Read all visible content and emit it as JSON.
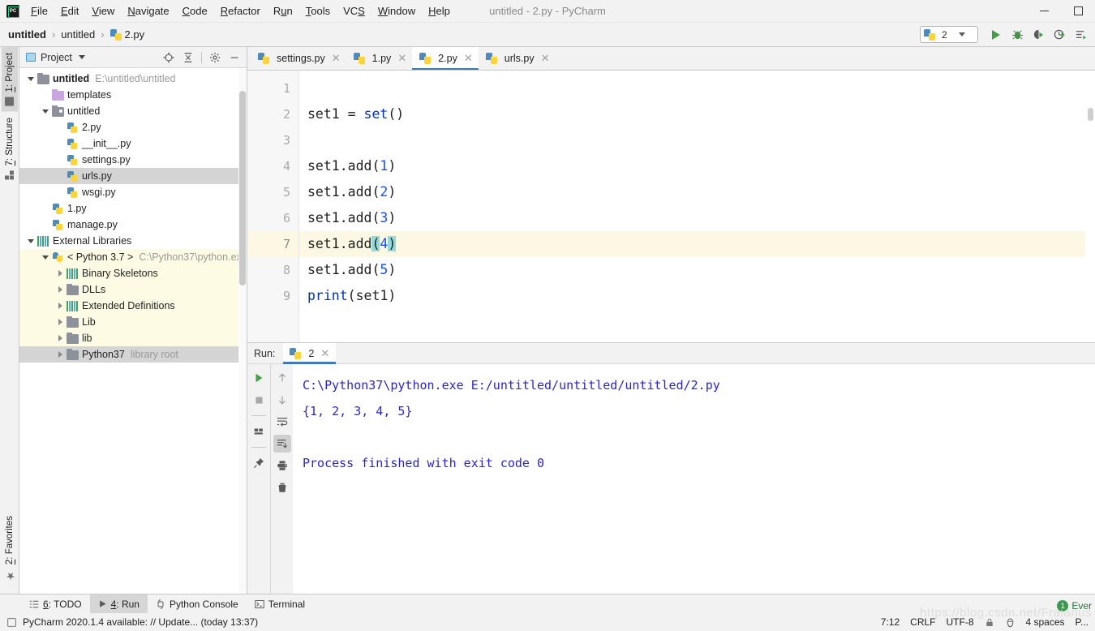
{
  "window": {
    "title": "untitled - 2.py - PyCharm",
    "logo_text": "PC",
    "minimize_icon": "minimize-icon",
    "maximize_icon": "maximize-icon"
  },
  "menu": [
    {
      "label": "File",
      "mnemonic": "F"
    },
    {
      "label": "Edit",
      "mnemonic": "E"
    },
    {
      "label": "View",
      "mnemonic": "V"
    },
    {
      "label": "Navigate",
      "mnemonic": "N"
    },
    {
      "label": "Code",
      "mnemonic": "C"
    },
    {
      "label": "Refactor",
      "mnemonic": "R"
    },
    {
      "label": "Run",
      "mnemonic": "u"
    },
    {
      "label": "Tools",
      "mnemonic": "T"
    },
    {
      "label": "VCS",
      "mnemonic": "S"
    },
    {
      "label": "Window",
      "mnemonic": "W"
    },
    {
      "label": "Help",
      "mnemonic": "H"
    }
  ],
  "breadcrumb": {
    "items": [
      "untitled",
      "untitled",
      "2.py"
    ],
    "separator": "›"
  },
  "run_config": {
    "name": "2",
    "icon": "python-file-icon",
    "buttons": [
      "run-button",
      "debug-button",
      "run-with-coverage-button",
      "profile-button",
      "more-run-button"
    ]
  },
  "left_stripe": {
    "top_tabs": [
      {
        "label": "1: Project",
        "mnemonic": "1",
        "icon": "project-folder-icon",
        "active": true
      },
      {
        "label": "7: Structure",
        "mnemonic": "7",
        "icon": "structure-icon",
        "active": false
      }
    ],
    "bottom_tabs": [
      {
        "label": "2: Favorites",
        "mnemonic": "2",
        "icon": "star-icon",
        "active": false
      }
    ]
  },
  "project_panel": {
    "title": "Project",
    "toolbar_icons": [
      "locate-target-icon",
      "collapse-all-icon",
      "settings-gear-icon",
      "hide-panel-icon"
    ],
    "tree": [
      {
        "depth": 0,
        "arrow": "down",
        "icon": "folder-icon",
        "label": "untitled",
        "sub": "E:\\untitled\\untitled",
        "bold": true,
        "state": "normal"
      },
      {
        "depth": 1,
        "arrow": "none",
        "icon": "folder-purple-icon",
        "label": "templates",
        "sub": "",
        "bold": false,
        "state": "normal"
      },
      {
        "depth": 1,
        "arrow": "down",
        "icon": "folder-source-icon",
        "label": "untitled",
        "sub": "",
        "bold": false,
        "state": "normal"
      },
      {
        "depth": 2,
        "arrow": "none",
        "icon": "python-file-icon",
        "label": "2.py",
        "sub": "",
        "bold": false,
        "state": "normal"
      },
      {
        "depth": 2,
        "arrow": "none",
        "icon": "python-file-icon",
        "label": "__init__.py",
        "sub": "",
        "bold": false,
        "state": "normal"
      },
      {
        "depth": 2,
        "arrow": "none",
        "icon": "python-file-icon",
        "label": "settings.py",
        "sub": "",
        "bold": false,
        "state": "normal"
      },
      {
        "depth": 2,
        "arrow": "none",
        "icon": "python-file-icon",
        "label": "urls.py",
        "sub": "",
        "bold": false,
        "state": "selected"
      },
      {
        "depth": 2,
        "arrow": "none",
        "icon": "python-file-icon",
        "label": "wsgi.py",
        "sub": "",
        "bold": false,
        "state": "normal"
      },
      {
        "depth": 1,
        "arrow": "none",
        "icon": "python-file-icon",
        "label": "1.py",
        "sub": "",
        "bold": false,
        "state": "normal"
      },
      {
        "depth": 1,
        "arrow": "none",
        "icon": "python-file-icon",
        "label": "manage.py",
        "sub": "",
        "bold": false,
        "state": "normal"
      },
      {
        "depth": 0,
        "arrow": "down",
        "icon": "library-icon",
        "label": "External Libraries",
        "sub": "",
        "bold": false,
        "state": "normal"
      },
      {
        "depth": 1,
        "arrow": "down",
        "icon": "python-sdk-icon",
        "label": "< Python 3.7 >",
        "sub": "C:\\Python37\\python.exe",
        "bold": false,
        "state": "yellow"
      },
      {
        "depth": 2,
        "arrow": "right",
        "icon": "library-icon",
        "label": "Binary Skeletons",
        "sub": "",
        "bold": false,
        "state": "yellow"
      },
      {
        "depth": 2,
        "arrow": "right",
        "icon": "folder-icon",
        "label": "DLLs",
        "sub": "",
        "bold": false,
        "state": "yellow"
      },
      {
        "depth": 2,
        "arrow": "right",
        "icon": "library-icon",
        "label": "Extended Definitions",
        "sub": "",
        "bold": false,
        "state": "yellow"
      },
      {
        "depth": 2,
        "arrow": "right",
        "icon": "folder-icon",
        "label": "Lib",
        "sub": "",
        "bold": false,
        "state": "yellow"
      },
      {
        "depth": 2,
        "arrow": "right",
        "icon": "folder-icon",
        "label": "lib",
        "sub": "",
        "bold": false,
        "state": "yellow"
      },
      {
        "depth": 2,
        "arrow": "right",
        "icon": "folder-icon",
        "label": "Python37",
        "sub": "library root",
        "bold": false,
        "state": "selected"
      }
    ]
  },
  "editor": {
    "tabs": [
      {
        "label": "settings.py",
        "icon": "python-file-icon",
        "active": false,
        "close_icon": "close-icon"
      },
      {
        "label": "1.py",
        "icon": "python-file-icon",
        "active": false,
        "close_icon": "close-icon"
      },
      {
        "label": "2.py",
        "icon": "python-file-icon",
        "active": true,
        "close_icon": "close-icon"
      },
      {
        "label": "urls.py",
        "icon": "python-file-icon",
        "active": false,
        "close_icon": "close-icon"
      }
    ],
    "line_numbers": [
      "1",
      "2",
      "3",
      "4",
      "5",
      "6",
      "7",
      "8",
      "9"
    ],
    "current_line": 7,
    "lines": [
      {
        "n": 1,
        "text": ""
      },
      {
        "n": 2,
        "text": "set1 = set()"
      },
      {
        "n": 3,
        "text": ""
      },
      {
        "n": 4,
        "text": "set1.add(1)"
      },
      {
        "n": 5,
        "text": "set1.add(2)"
      },
      {
        "n": 6,
        "text": "set1.add(3)"
      },
      {
        "n": 7,
        "text": "set1.add(4)"
      },
      {
        "n": 8,
        "text": "set1.add(5)"
      },
      {
        "n": 9,
        "text": "print(set1)"
      }
    ]
  },
  "run_window": {
    "label": "Run:",
    "tab_label": "2",
    "tab_icon": "python-file-icon",
    "left_tools": [
      "rerun-button",
      "stop-button",
      "restore-layout-button",
      "pin-tab-button"
    ],
    "right_tools": [
      "up-stack-button",
      "down-stack-button",
      "soft-wrap-button",
      "scroll-to-end-button",
      "print-button",
      "clear-all-button"
    ],
    "console_lines": [
      "C:\\Python37\\python.exe E:/untitled/untitled/untitled/2.py",
      "{1, 2, 3, 4, 5}",
      "",
      "Process finished with exit code 0"
    ],
    "console_color": "#2a25c9"
  },
  "bottom_toolbar": [
    {
      "label": "6: TODO",
      "mnemonic": "6",
      "icon": "todo-icon",
      "active": false
    },
    {
      "label": "4: Run",
      "mnemonic": "4",
      "icon": "run-triangle-icon",
      "active": true
    },
    {
      "label": "Python Console",
      "icon": "python-console-icon",
      "active": false
    },
    {
      "label": "Terminal",
      "icon": "terminal-icon",
      "active": false
    }
  ],
  "status_bar": {
    "message_icon": "update-notification-icon",
    "message": "PyCharm 2020.1.4 available: // Update... (today 13:37)",
    "caret_position": "7:12",
    "line_separator": "CRLF",
    "encoding": "UTF-8",
    "lock_icon": "read-only-lock-icon",
    "inspection_icon": "hector-inspection-icon",
    "indent": "4 spaces",
    "branch": "P...",
    "event_badge_count": "1",
    "event_label": "Ever",
    "watermark": "https://blog.csdn.net/Fraianus"
  }
}
